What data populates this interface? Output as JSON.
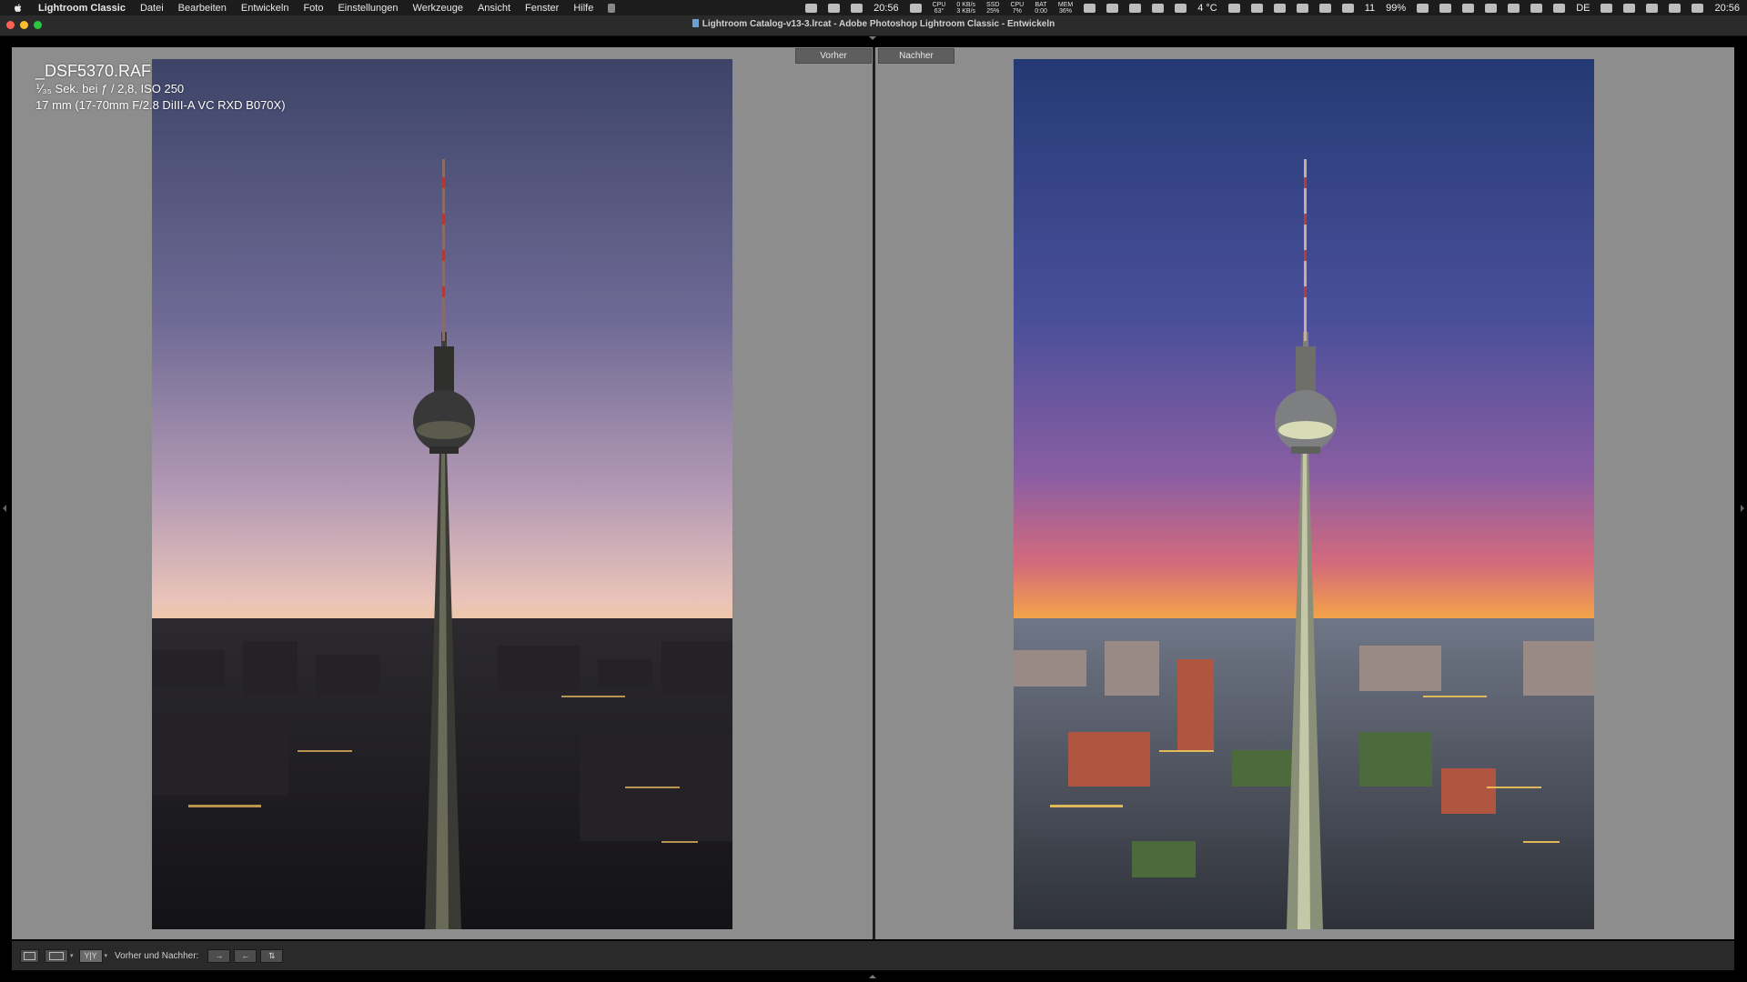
{
  "menubar": {
    "app_name": "Lightroom Classic",
    "items": [
      "Datei",
      "Bearbeiten",
      "Entwickeln",
      "Foto",
      "Einstellungen",
      "Werkzeuge",
      "Ansicht",
      "Fenster",
      "Hilfe"
    ],
    "clock_center": "20:56",
    "cpu_label": "CPU",
    "cpu_temp": "63°",
    "net_up": "0 KB/s",
    "net_down": "3 KB/s",
    "ssd_label": "SSD",
    "ssd_value": "25%",
    "cpu2_label": "CPU",
    "cpu2_value": "7%",
    "bat_label": "BAT",
    "bat_value": "0:00",
    "mem_label": "MEM",
    "mem_value": "36%",
    "weather": "4 °C",
    "calendar_day": "11",
    "battery_percent": "99%",
    "input_source": "DE",
    "clock_right": "20:56"
  },
  "window": {
    "title": "Lightroom Catalog-v13-3.lrcat - Adobe Photoshop Lightroom Classic - Entwickeln"
  },
  "view": {
    "before_label": "Vorher",
    "after_label": "Nachher"
  },
  "photo_info": {
    "filename": "_DSF5370.RAF",
    "exposure": "⅟₃₅ Sek. bei ƒ / 2,8, ISO 250",
    "lens": "17 mm (17-70mm F/2.8 DiIII-A VC RXD B070X)"
  },
  "toolbar": {
    "view_mode_label": "Y|Y",
    "before_after_label": "Vorher und Nachher:"
  },
  "colors": {
    "workspace_bg": "#8d8d8d",
    "toolbar_bg": "#2a2a2a",
    "menubar_bg": "#1c1c1c"
  }
}
